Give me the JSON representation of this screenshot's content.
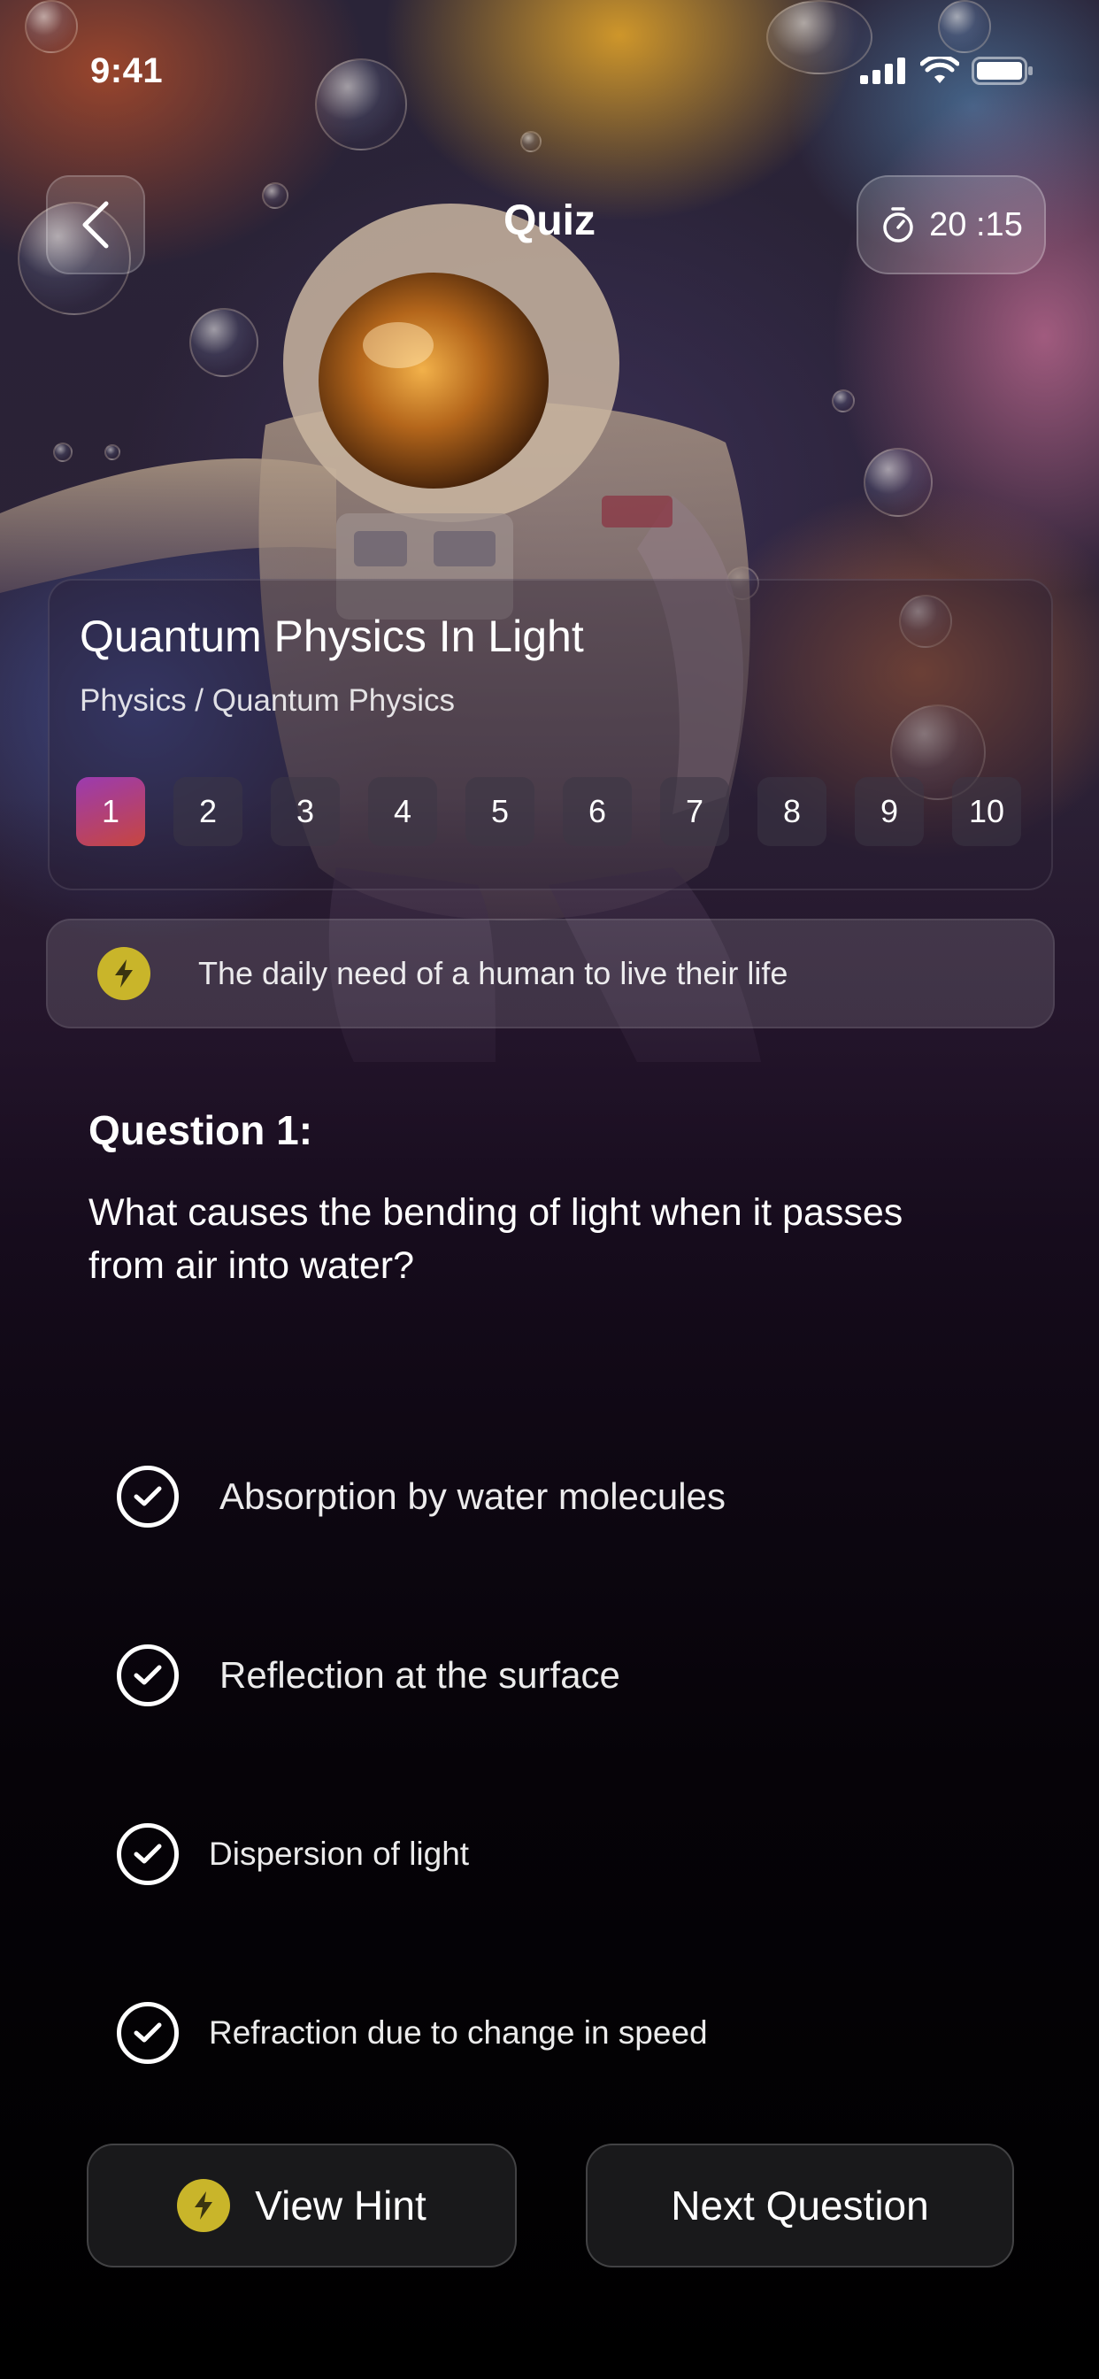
{
  "status_bar": {
    "time": "9:41"
  },
  "header": {
    "title": "Quiz",
    "timer": "20 :15"
  },
  "quiz": {
    "title": "Quantum Physics In Light",
    "category": "Physics / Quantum Physics",
    "pages": [
      "1",
      "2",
      "3",
      "4",
      "5",
      "6",
      "7",
      "8",
      "9",
      "10"
    ],
    "current_page": "1"
  },
  "daily_tip": {
    "text": "The daily need of a human to live their life"
  },
  "question": {
    "label": "Question 1:",
    "text": "What causes the bending of light when it passes from air into water?",
    "options": [
      "Absorption by water molecules",
      "Reflection at the surface",
      "Dispersion of light",
      "Refraction due to change in speed"
    ]
  },
  "actions": {
    "hint_label": "View Hint",
    "next_label": "Next Question"
  },
  "colors": {
    "accent_gradient_start": "#9b3bb0",
    "accent_gradient_end": "#c7463f",
    "bolt": "#c9b52a"
  },
  "icons": {
    "back": "chevron-left-icon",
    "timer": "stopwatch-icon",
    "bolt": "lightning-icon",
    "option": "check-circle-icon"
  }
}
